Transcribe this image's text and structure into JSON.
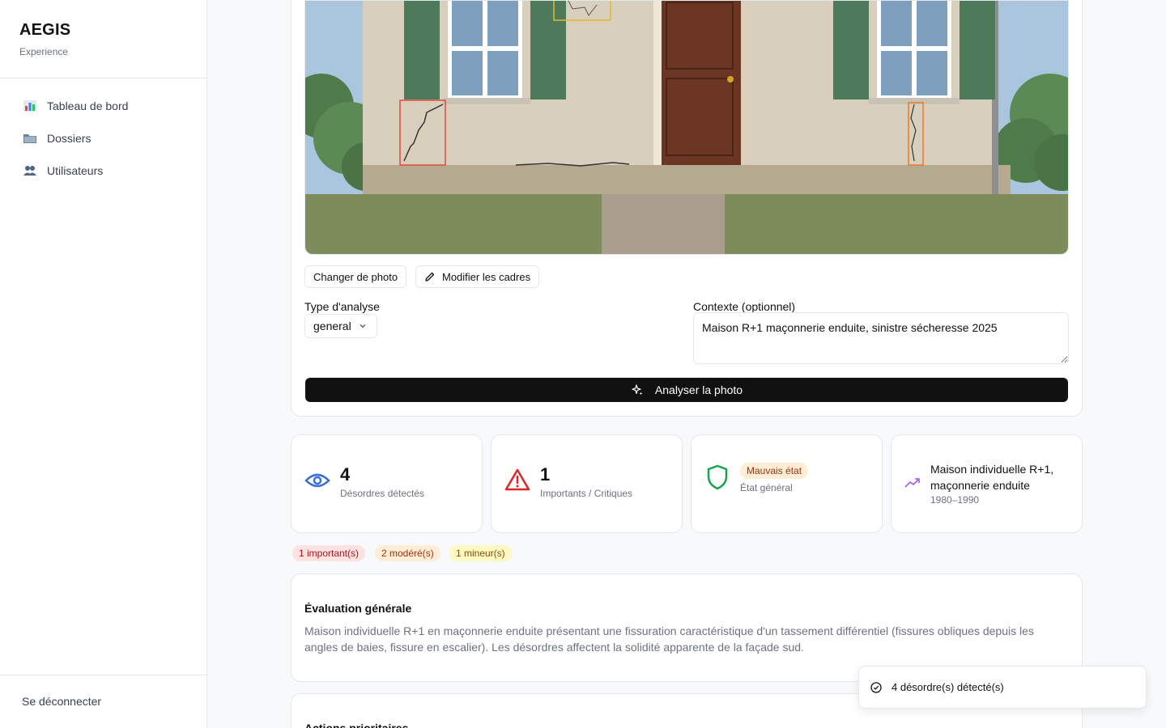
{
  "sidebar": {
    "brand_title": "AEGIS",
    "brand_sub": "Experience",
    "items": [
      {
        "label": "Tableau de bord",
        "icon": "bar-chart-icon"
      },
      {
        "label": "Dossiers",
        "icon": "folder-icon"
      },
      {
        "label": "Utilisateurs",
        "icon": "users-icon"
      }
    ],
    "logout": "Se déconnecter"
  },
  "photo_tools": {
    "change_photo": "Changer de photo",
    "edit_frames": "Modifier les cadres"
  },
  "form": {
    "analysis_type_label": "Type d'analyse",
    "analysis_type_value": "general",
    "context_label": "Contexte (optionnel)",
    "context_value": "Maison R+1 maçonnerie enduite, sinistre sécheresse 2025",
    "analyze_button": "Analyser la photo"
  },
  "stats": {
    "detected_count": "4",
    "detected_label": "Désordres détectés",
    "critical_count": "1",
    "critical_label": "Importants / Critiques",
    "state_badge": "Mauvais état",
    "state_label": "État général",
    "building_line1": "Maison individuelle R+1,",
    "building_line2": "maçonnerie enduite",
    "building_period": "1980–1990"
  },
  "pills": {
    "important": "1 important(s)",
    "moderate": "2 modéré(s)",
    "minor": "1 mineur(s)"
  },
  "evaluation": {
    "title": "Évaluation générale",
    "text": "Maison individuelle R+1 en maçonnerie enduite présentant une fissuration caractéristique d'un tassement différentiel (fissures obliques depuis les angles de baies, fissure en escalier). Les désordres affectent la solidité apparente de la façade sud."
  },
  "actions": {
    "title": "Actions prioritaires"
  },
  "toast": {
    "message": "4 désordre(s) détecté(s)"
  },
  "colors": {
    "accent_dark": "#111111",
    "eye_blue": "#3b6fd8",
    "warning_red": "#dc2626",
    "shield_green": "#16a34a",
    "trend_purple": "#a855f7",
    "badge_orange_bg": "#ffedd5",
    "pill_red_bg": "#fee2e2",
    "pill_orange_bg": "#ffedd5",
    "pill_yellow_bg": "#fef9c3"
  }
}
